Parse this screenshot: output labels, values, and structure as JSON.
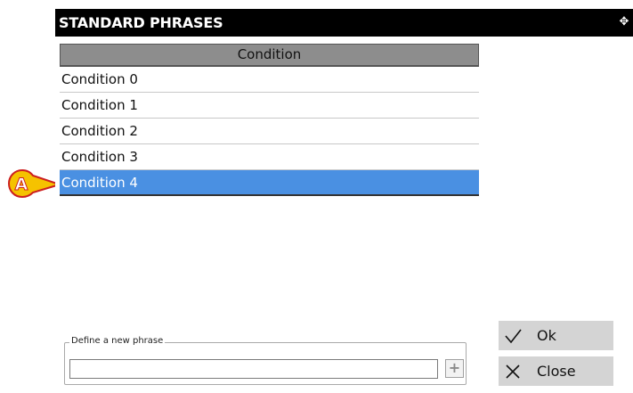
{
  "dialog": {
    "title": "STANDARD PHRASES",
    "move_icon": "move-icon"
  },
  "table": {
    "column_header": "Condition",
    "rows": [
      {
        "label": "Condition 0",
        "selected": false
      },
      {
        "label": "Condition 1",
        "selected": false
      },
      {
        "label": "Condition 2",
        "selected": false
      },
      {
        "label": "Condition 3",
        "selected": false
      },
      {
        "label": "Condition 4",
        "selected": true
      }
    ]
  },
  "new_phrase": {
    "legend": "Define a new phrase",
    "value": "",
    "add_icon": "plus-icon"
  },
  "buttons": {
    "ok_label": "Ok",
    "ok_icon": "check-icon",
    "close_label": "Close",
    "close_icon": "close-icon"
  },
  "callout": {
    "letter": "A",
    "fill": "#f5c200",
    "stroke": "#cc1f1f"
  },
  "colors": {
    "titlebar": "#000000",
    "selected_row": "#4a90e2",
    "header": "#8d8d8d",
    "button": "#d4d4d4"
  }
}
